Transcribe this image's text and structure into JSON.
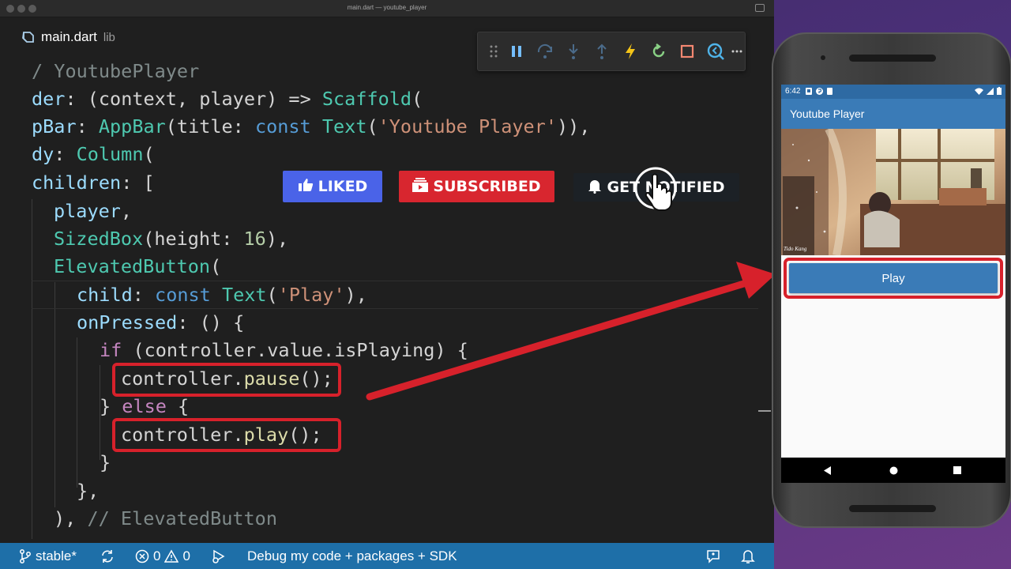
{
  "window": {
    "title": "main.dart — youtube_player"
  },
  "tab": {
    "filename": "main.dart",
    "directory": "lib"
  },
  "debug_toolbar": {
    "buttons": [
      "drag-handle",
      "pause",
      "step-over",
      "step-into",
      "step-out",
      "hot-reload",
      "hot-restart",
      "stop",
      "devtools",
      "more"
    ]
  },
  "code": {
    "lines": [
      "/ YoutubePlayer",
      "der: (context, player) => Scaffold(",
      "pBar: AppBar(title: const Text('Youtube Player')),",
      "dy: Column(",
      "children: [",
      "player,",
      "SizedBox(height: 16),",
      "ElevatedButton(",
      "child: const Text('Play'),",
      "onPressed: () {",
      "if (controller.value.isPlaying) {",
      "controller.pause();",
      "} else {",
      "controller.play();",
      "}",
      "},",
      "), // ElevatedButton"
    ]
  },
  "statusbar": {
    "branch": "stable*",
    "errors": "0",
    "warnings": "0",
    "debug_mode": "Debug my code + packages + SDK"
  },
  "overlay": {
    "liked": "LIKED",
    "subscribed": "SUBSCRIBED",
    "notify": "GET NOTIFIED"
  },
  "phone": {
    "time": "6:42",
    "app_title": "Youtube Player",
    "video_caption": "Tido Kang",
    "play_label": "Play"
  },
  "colors": {
    "highlight": "#d7212b",
    "statusbar": "#1e6fa8",
    "app_bar": "#3a7bb7"
  }
}
